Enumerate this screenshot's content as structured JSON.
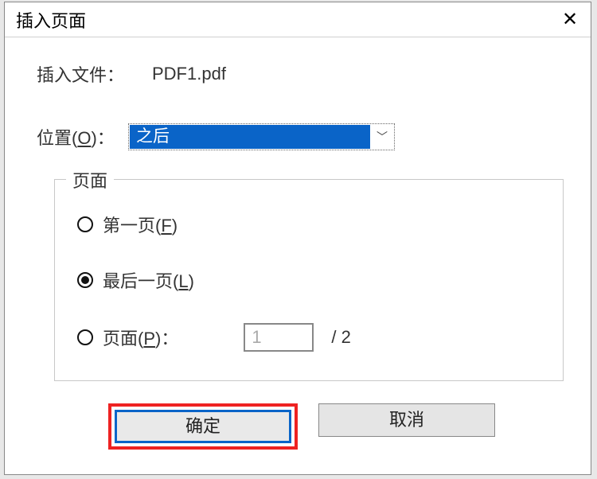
{
  "dialog": {
    "title": "插入页面",
    "close_glyph": "✕"
  },
  "file": {
    "label": "插入文件：",
    "name": "PDF1.pdf"
  },
  "position": {
    "label_prefix": "位置(",
    "label_hotkey": "O",
    "label_suffix": ")：",
    "selected": "之后",
    "arrow": "﹀"
  },
  "page_group": {
    "legend": "页面",
    "first": {
      "text_prefix": "第一页(",
      "hotkey": "F",
      "text_suffix": ")"
    },
    "last": {
      "text_prefix": "最后一页(",
      "hotkey": "L",
      "text_suffix": ")"
    },
    "num": {
      "text_prefix": "页面(",
      "hotkey": "P",
      "text_suffix": ")：",
      "value": "1",
      "total": "/ 2"
    }
  },
  "buttons": {
    "ok": "确定",
    "cancel": "取消"
  }
}
